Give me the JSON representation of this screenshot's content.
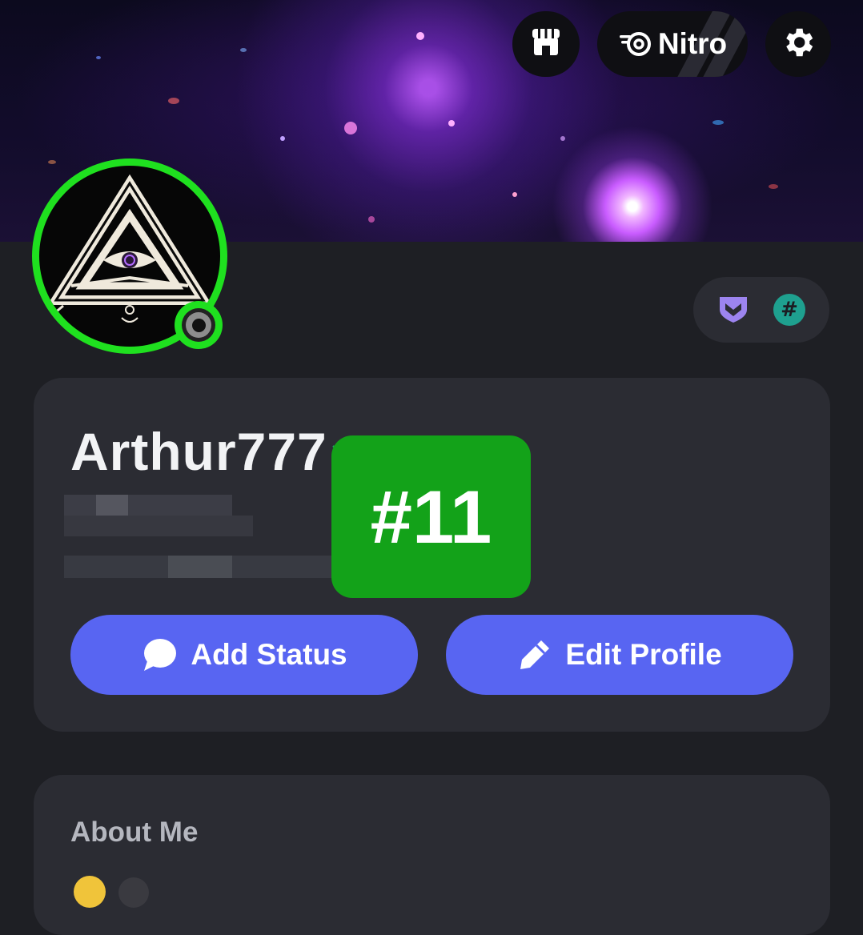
{
  "header": {
    "shop_icon": "shop-icon",
    "nitro_label": "Nitro",
    "nitro_icon": "nitro-icon",
    "settings_icon": "gear-icon"
  },
  "profile": {
    "username": "Arthur777",
    "status": "online",
    "badges": [
      "hypesquad-icon",
      "hash-icon"
    ],
    "hash_badge_text": "#",
    "overlay_label": "#11"
  },
  "actions": {
    "add_status_label": "Add Status",
    "edit_profile_label": "Edit Profile"
  },
  "about": {
    "title": "About Me"
  },
  "colors": {
    "accent": "#5865f2",
    "online_ring": "#1fe01f",
    "overlay_badge": "#13a219",
    "card_bg": "#2b2c33",
    "page_bg": "#1e1f24"
  }
}
